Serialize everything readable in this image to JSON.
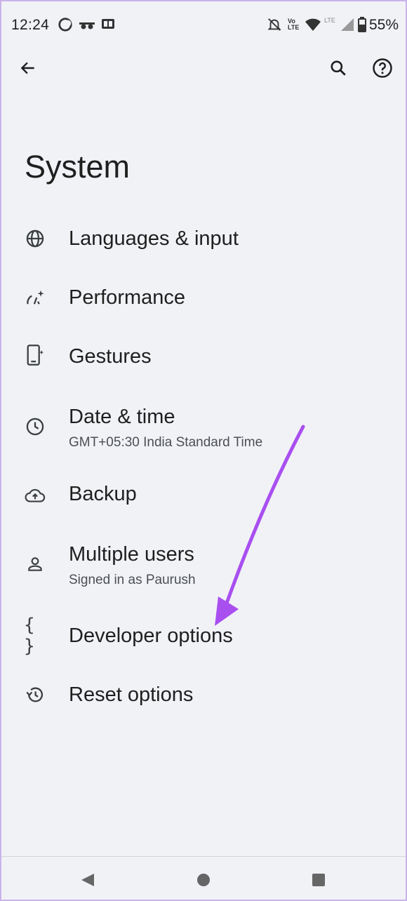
{
  "status_bar": {
    "time": "12:24",
    "battery": "55%",
    "icons": [
      "moon-icon",
      "incognito-icon",
      "ge-icon",
      "bell-off-icon",
      "volte-icon",
      "wifi-icon",
      "lte-signal-icon",
      "battery-icon"
    ]
  },
  "top_bar": {
    "back_icon": "arrow-left-icon",
    "search_icon": "search-icon",
    "help_icon": "help-icon"
  },
  "page": {
    "title": "System"
  },
  "items": [
    {
      "label": "Languages & input",
      "icon": "globe-icon"
    },
    {
      "label": "Performance",
      "icon": "performance-icon"
    },
    {
      "label": "Gestures",
      "icon": "gesture-phone-icon"
    },
    {
      "label": "Date & time",
      "sublabel": "GMT+05:30 India Standard Time",
      "icon": "clock-icon"
    },
    {
      "label": "Backup",
      "icon": "cloud-upload-icon"
    },
    {
      "label": "Multiple users",
      "sublabel": "Signed in as Paurush",
      "icon": "person-icon"
    },
    {
      "label": "Developer options",
      "icon": "braces-icon"
    },
    {
      "label": "Reset options",
      "icon": "history-icon"
    }
  ],
  "nav_bar": {
    "icons": [
      "back-triangle-icon",
      "home-circle-icon",
      "recents-square-icon"
    ]
  },
  "colors": {
    "background": "#f1f2f6",
    "annotation_arrow": "#a94ff0",
    "text": "#1f1f1f"
  }
}
